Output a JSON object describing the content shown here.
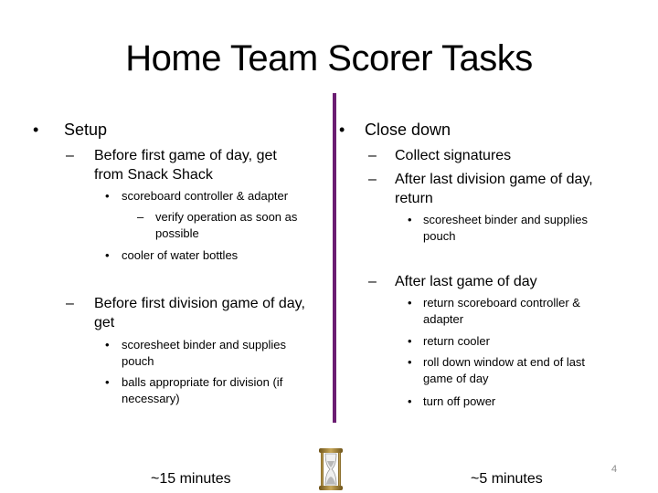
{
  "title": "Home Team Scorer Tasks",
  "colors": {
    "divider": "#6b1d72",
    "hourglass_frame": "#8a6d2a"
  },
  "left": {
    "heading": "Setup",
    "sections": [
      {
        "label": "Before first game of day, get from Snack Shack",
        "label_lines": [
          "Before first game of day, get",
          "from Snack Shack"
        ],
        "items": [
          {
            "text": "scoreboard controller & adapter",
            "sub": [
              "verify operation as soon as",
              "possible"
            ]
          },
          {
            "text": "cooler of water bottles"
          }
        ]
      },
      {
        "label_lines": [
          "Before first division game of day,",
          "get"
        ],
        "items": [
          {
            "lines": [
              "scoresheet binder and supplies",
              "pouch"
            ]
          },
          {
            "lines": [
              "balls appropriate for division (if",
              "necessary)"
            ]
          }
        ]
      }
    ],
    "time": "~15 minutes"
  },
  "right": {
    "heading": "Close down",
    "sections": [
      {
        "label_lines": [
          "Collect signatures"
        ]
      },
      {
        "label_lines": [
          "After last division game of day,",
          "return"
        ],
        "items": [
          {
            "lines": [
              "scoresheet binder and supplies",
              "pouch"
            ]
          }
        ]
      },
      {
        "label_lines": [
          "After last game of day"
        ],
        "items": [
          {
            "lines": [
              "return scoreboard controller &",
              "adapter"
            ]
          },
          {
            "lines": [
              "return cooler"
            ]
          },
          {
            "lines": [
              "roll down window at end of last",
              "game of day"
            ]
          },
          {
            "lines": [
              "turn off power"
            ]
          }
        ]
      }
    ],
    "time": "~5 minutes"
  },
  "icons": {
    "center": "hourglass-icon"
  },
  "page_number": "4"
}
